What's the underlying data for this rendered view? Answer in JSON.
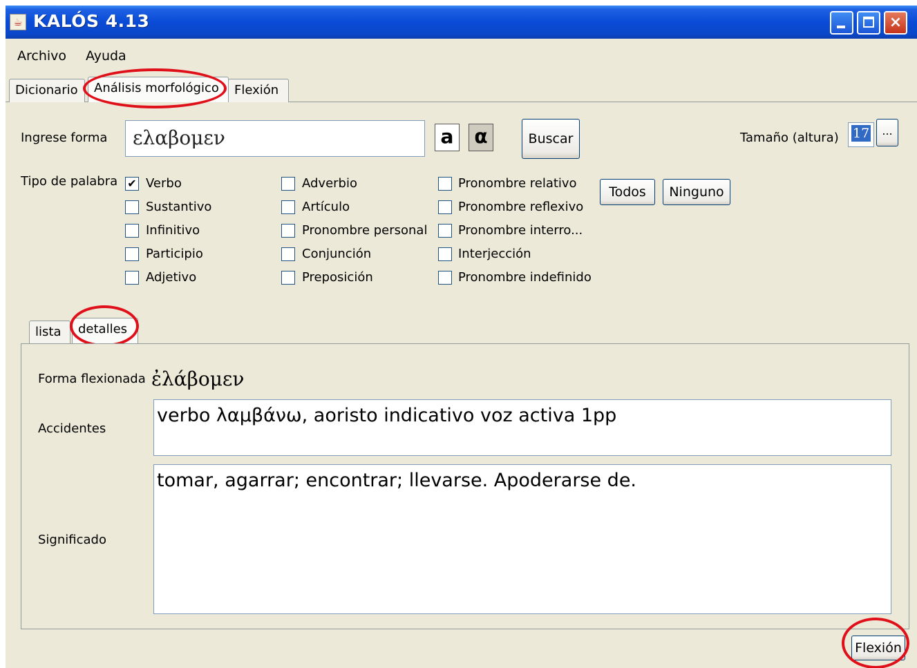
{
  "window": {
    "title": "KALÓS 4.13",
    "close_glyph": "×"
  },
  "menu": [
    "Archivo",
    "Ayuda"
  ],
  "tabs": [
    "Dicionario",
    "Análisis morfológico",
    "Flexión"
  ],
  "form": {
    "input_label": "Ingrese forma",
    "input_value": "ελαβομεν",
    "latin_button": "a",
    "greek_button": "α",
    "search_button": "Buscar",
    "size_label": "Tamaño (altura)",
    "size_value": "17",
    "size_more_button": "...",
    "word_type_label": "Tipo de palabra",
    "all_button": "Todos",
    "none_button": "Ninguno"
  },
  "word_types": [
    {
      "label": "Verbo",
      "checked": true
    },
    {
      "label": "Sustantivo",
      "checked": false
    },
    {
      "label": "Infinitivo",
      "checked": false
    },
    {
      "label": "Participio",
      "checked": false
    },
    {
      "label": "Adjetivo",
      "checked": false
    },
    {
      "label": "Adverbio",
      "checked": false
    },
    {
      "label": "Artículo",
      "checked": false
    },
    {
      "label": "Pronombre personal",
      "checked": false
    },
    {
      "label": "Conjunción",
      "checked": false
    },
    {
      "label": "Preposición",
      "checked": false
    },
    {
      "label": "Pronombre relativo",
      "checked": false
    },
    {
      "label": "Pronombre reflexivo",
      "checked": false
    },
    {
      "label": "Pronombre interro...",
      "checked": false
    },
    {
      "label": "Interjección",
      "checked": false
    },
    {
      "label": "Pronombre indefinido",
      "checked": false
    }
  ],
  "check_glyph": "✔",
  "subtabs": [
    "lista",
    "detalles"
  ],
  "details": {
    "inflected_label": "Forma flexionada",
    "inflected_value": "ἐλάβομεν",
    "accidents_label": "Accidentes",
    "accidents_value": "verbo λαμβάνω, aoristo indicativo voz activa 1pp",
    "meaning_label": "Significado",
    "meaning_value": "tomar, agarrar; encontrar; llevarse. Apoderarse de."
  },
  "flexion_button": "Flexión"
}
